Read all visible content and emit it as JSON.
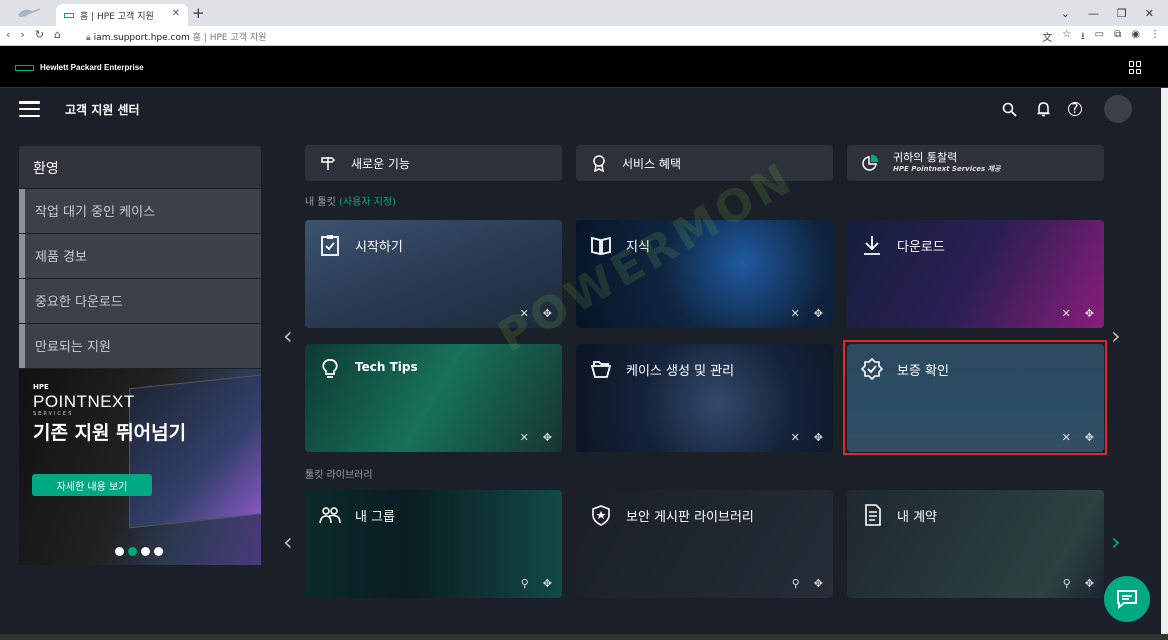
{
  "browser": {
    "tab_title": "홈 | HPE 고객 지원",
    "url_domain": "iam.support.hpe.com",
    "url_title": "홈 | HPE 고객 지원"
  },
  "brand": {
    "name": "Hewlett Packard Enterprise",
    "accent": "#01a982"
  },
  "header": {
    "title": "고객 지원 센터"
  },
  "sidebar": {
    "heading": "환영",
    "items": [
      {
        "label": "작업 대기 중인 케이스"
      },
      {
        "label": "제품 경보"
      },
      {
        "label": "중요한 다운로드"
      },
      {
        "label": "만료되는 지원"
      }
    ]
  },
  "promo": {
    "brand_small": "HPE",
    "brand_big": "POINTNEXT",
    "brand_sub": "SERVICES",
    "headline": "기존 지원 뛰어넘기",
    "cta": "자세한 내용 보기",
    "slides": 4,
    "active_slide": 2
  },
  "quick_links": [
    {
      "label": "새로운 기능"
    },
    {
      "label": "서비스 혜택"
    },
    {
      "label": "귀하의 통찰력",
      "sub": "HPE Pointnext Services 제공"
    }
  ],
  "my_tools": {
    "heading": "내 툴킷",
    "customize": "(사용자 지정)",
    "cards": [
      {
        "label": "시작하기"
      },
      {
        "label": "지식"
      },
      {
        "label": "다운로드"
      },
      {
        "label": "Tech Tips"
      },
      {
        "label": "케이스 생성 및 관리"
      },
      {
        "label": "보증 확인"
      }
    ]
  },
  "library": {
    "heading": "툴킷 라이브러리",
    "cards": [
      {
        "label": "내 그룹"
      },
      {
        "label": "보안 게시판 라이브러리"
      },
      {
        "label": "내 계약"
      }
    ]
  },
  "watermark": "POWERMON",
  "highlight_color": "#e3262d"
}
